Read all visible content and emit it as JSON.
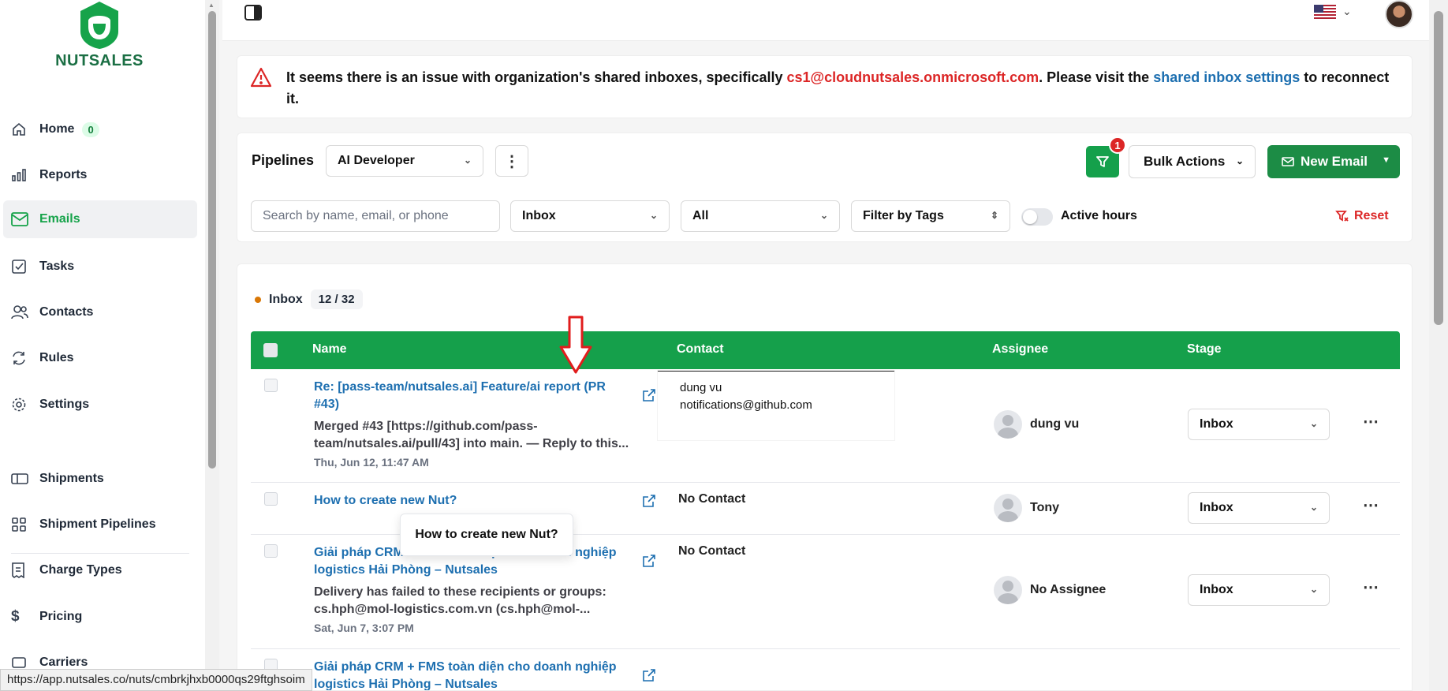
{
  "brand": {
    "name": "NUTSALES",
    "color": "#15a04b"
  },
  "sidebar": {
    "items": [
      {
        "label": "Home",
        "icon": "home-icon",
        "badge": "0"
      },
      {
        "label": "Reports",
        "icon": "bar-chart-icon"
      },
      {
        "label": "Emails",
        "icon": "mail-icon",
        "active": true
      },
      {
        "label": "Tasks",
        "icon": "checkbox-icon"
      },
      {
        "label": "Contacts",
        "icon": "users-icon"
      },
      {
        "label": "Rules",
        "icon": "refresh-icon"
      },
      {
        "label": "Settings",
        "icon": "gear-icon"
      },
      {
        "label": "Shipments",
        "icon": "box-icon"
      },
      {
        "label": "Shipment Pipelines",
        "icon": "grid-icon"
      },
      {
        "label": "Charge Types",
        "icon": "receipt-icon"
      },
      {
        "label": "Pricing",
        "icon": "dollar-icon"
      },
      {
        "label": "Carriers",
        "icon": "truck-icon"
      }
    ]
  },
  "alert": {
    "text_before": "It seems there is an issue with organization's shared inboxes, specifically ",
    "email": "cs1@cloudnutsales.onmicrosoft.com",
    "text_middle": ". Please visit the ",
    "link": "shared inbox settings",
    "text_after": " to reconnect it.",
    "email_color": "#dc2626",
    "link_color": "#1d6fb0"
  },
  "filters": {
    "pipelines_label": "Pipelines",
    "pipeline_value": "AI Developer",
    "filter_badge": "1",
    "bulk_actions": "Bulk Actions",
    "new_email": "New Email",
    "search_placeholder": "Search by name, email, or phone",
    "mailbox_value": "Inbox",
    "status_value": "All",
    "tags_value": "Filter by Tags",
    "active_hours": "Active hours",
    "reset": "Reset"
  },
  "inbox": {
    "title": "Inbox",
    "count": "12 / 32",
    "columns": {
      "name": "Name",
      "contact": "Contact",
      "assignee": "Assignee",
      "stage": "Stage"
    },
    "rows": [
      {
        "subject": "Re: [pass-team/nutsales.ai] Feature/ai report (PR #43)",
        "preview": "Merged #43 [https://github.com/pass-team/nutsales.ai/pull/43] into main. — Reply to this...",
        "date": "Thu, Jun 12, 11:47 AM",
        "contact_name": "dung vu",
        "contact_email": "notifications@github.com",
        "assignee": "dung vu",
        "stage": "Inbox"
      },
      {
        "subject": "How to create new Nut?",
        "preview": "",
        "date": "",
        "contact": "No Contact",
        "assignee": "Tony",
        "stage": "Inbox"
      },
      {
        "subject": "Giải pháp CRM + FMS toàn diện cho doanh nghiệp logistics Hải Phòng – Nutsales",
        "preview": "Delivery has failed to these recipients or groups: cs.hph@mol-logistics.com.vn (cs.hph@mol-...",
        "date": "Sat, Jun 7, 3:07 PM",
        "contact": "No Contact",
        "assignee": "No Assignee",
        "stage": "Inbox"
      },
      {
        "subject": "Giải pháp CRM + FMS toàn diện cho doanh nghiệp logistics Hải Phòng – Nutsales",
        "preview": "",
        "date": "",
        "contact": "",
        "assignee": "",
        "stage": ""
      }
    ]
  },
  "tooltip": "How to create new Nut?",
  "status_url": "https://app.nutsales.co/nuts/cmbrkjhxb0000qs29ftghsoim"
}
